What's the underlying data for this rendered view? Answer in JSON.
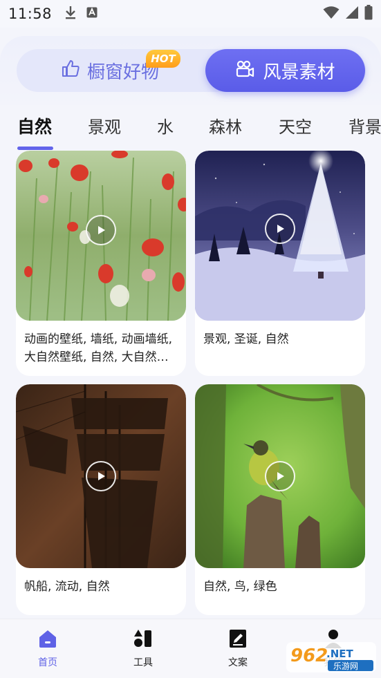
{
  "status_bar": {
    "time": "11:58"
  },
  "segments": {
    "left_label": "橱窗好物",
    "hot_badge": "HOT",
    "right_label": "风景素材",
    "accent_color": "#5f62e6"
  },
  "tabs": [
    {
      "label": "自然",
      "active": true
    },
    {
      "label": "景观",
      "active": false
    },
    {
      "label": "水",
      "active": false
    },
    {
      "label": "森林",
      "active": false
    },
    {
      "label": "天空",
      "active": false
    },
    {
      "label": "背景",
      "active": false
    }
  ],
  "cards": [
    {
      "text": "动画的壁纸, 墙纸, 动画墙纸, 大自然壁纸, 自然, 大自然壁纸",
      "scene": "poppy-field"
    },
    {
      "text": "景观, 圣诞, 自然",
      "scene": "christmas-tree"
    },
    {
      "text": "帆船, 流动, 自然",
      "scene": "sailing-ship"
    },
    {
      "text": "自然, 鸟, 绿色",
      "scene": "bird-on-stump"
    }
  ],
  "bottom_nav": [
    {
      "label": "首页",
      "icon": "home-icon",
      "active": true
    },
    {
      "label": "工具",
      "icon": "tools-icon",
      "active": false
    },
    {
      "label": "文案",
      "icon": "document-edit-icon",
      "active": false
    },
    {
      "label": "我的",
      "icon": "profile-icon",
      "active": false
    }
  ],
  "watermark": {
    "number": "962",
    "suffix": ".NET",
    "subtitle": "乐游网"
  }
}
